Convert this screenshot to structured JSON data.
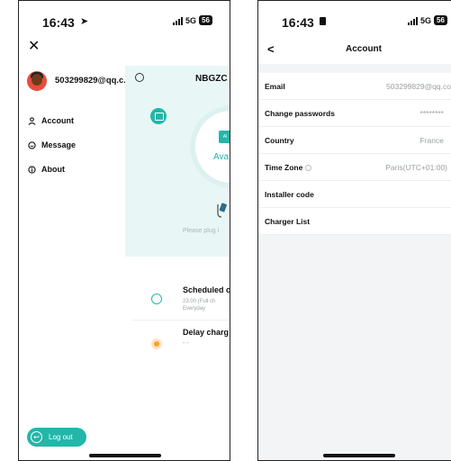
{
  "left_phone": {
    "status": {
      "time": "16:43",
      "network": "5G",
      "battery": "56"
    },
    "drawer": {
      "email": "503299829@qq.c...",
      "menu": [
        {
          "label": "Account",
          "icon": "user-icon"
        },
        {
          "label": "Message",
          "icon": "message-icon"
        },
        {
          "label": "About",
          "icon": "info-icon"
        }
      ],
      "logout_label": "Log out"
    },
    "background_app": {
      "title": "NBGZC",
      "status_text": "Ava",
      "badge_text": "Al",
      "plug_hint": "Please plug i",
      "scheduled_title": "Scheduled c",
      "scheduled_sub_1": "23:00 (Full ch",
      "scheduled_sub_2": "Everyday",
      "delay_title": "Delay charg",
      "delay_sub": "- -"
    }
  },
  "right_phone": {
    "status": {
      "time": "16:43",
      "network": "5G",
      "battery": "56"
    },
    "nav": {
      "title": "Account",
      "back": "<"
    },
    "fields": [
      {
        "label": "Email",
        "value": "503299829@qq.co"
      },
      {
        "label": "Change passwords",
        "value": "********"
      },
      {
        "label": "Country",
        "value": "France"
      },
      {
        "label": "Time Zone",
        "value": "Paris(UTC+01:00)",
        "info": true
      },
      {
        "label": "Installer code",
        "value": ""
      },
      {
        "label": "Charger List",
        "value": ""
      }
    ]
  },
  "colors": {
    "accent": "#22b7a8",
    "delay": "#f3a431",
    "list_bg": "#f3f4f5"
  }
}
